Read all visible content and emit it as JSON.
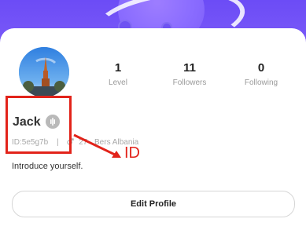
{
  "profile": {
    "name": "Jack",
    "id_text": "ID:5e5g7b",
    "separator": "|",
    "age": "27",
    "location_text": "Bers Albania",
    "intro": "Introduce yourself.",
    "edit_button": "Edit Profile"
  },
  "stats": [
    {
      "value": "1",
      "label": "Level"
    },
    {
      "value": "11",
      "label": "Followers"
    },
    {
      "value": "0",
      "label": "Following"
    }
  ],
  "annotation": {
    "label": "ID",
    "color": "#e2231a"
  },
  "colors": {
    "hero": "#7a5af8",
    "text_muted": "#9a9a9a"
  },
  "icons": {
    "voice": "voice-wave-icon",
    "gender": "gender-icon"
  }
}
